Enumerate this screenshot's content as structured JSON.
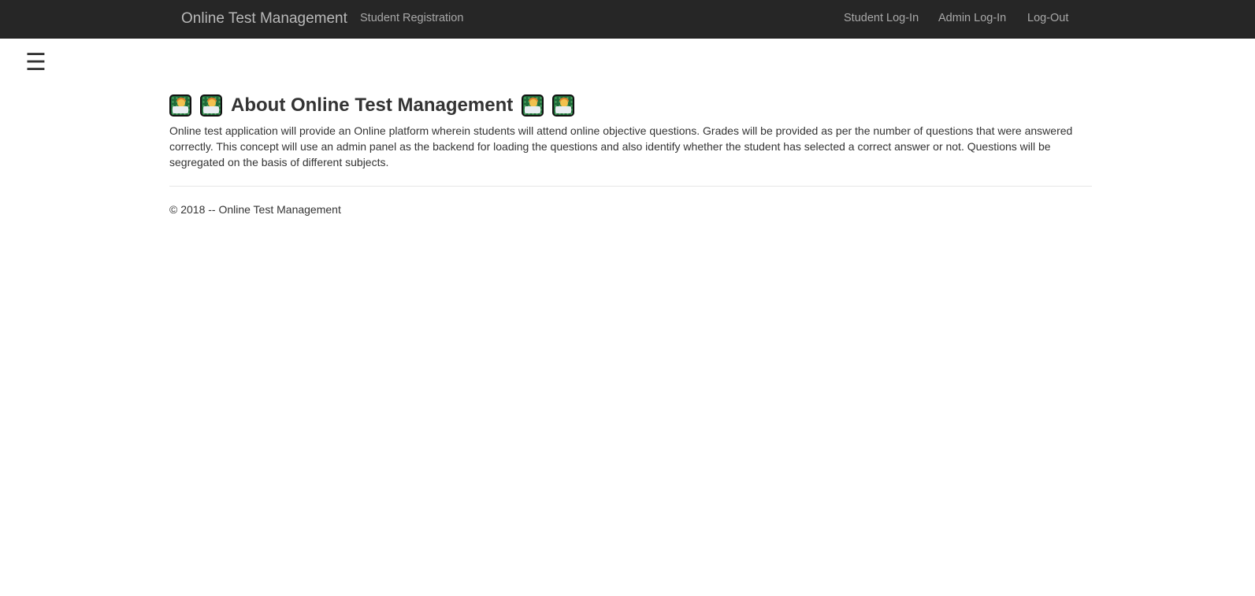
{
  "navbar": {
    "brand": "Online Test Management",
    "left_links": [
      "Student Registration"
    ],
    "right_links": [
      "Student Log-In",
      "Admin Log-In",
      "Log-Out"
    ],
    "background": "#262626"
  },
  "sidebar_toggle": {
    "icon": "hamburger-menu-icon",
    "glyph": "☰"
  },
  "main": {
    "heading": "About Online Test Management",
    "heading_icon": "student-laptop-emoji",
    "description": "Online test application will provide an Online platform wherein students will attend online objective questions. Grades will be provided as per the number of questions that were answered correctly. This concept will use an admin panel as the backend for loading the questions and also identify whether the student has selected a correct answer or not. Questions will be segregated on the basis of different subjects."
  },
  "footer": {
    "text": "© 2018 -- Online Test Management"
  }
}
